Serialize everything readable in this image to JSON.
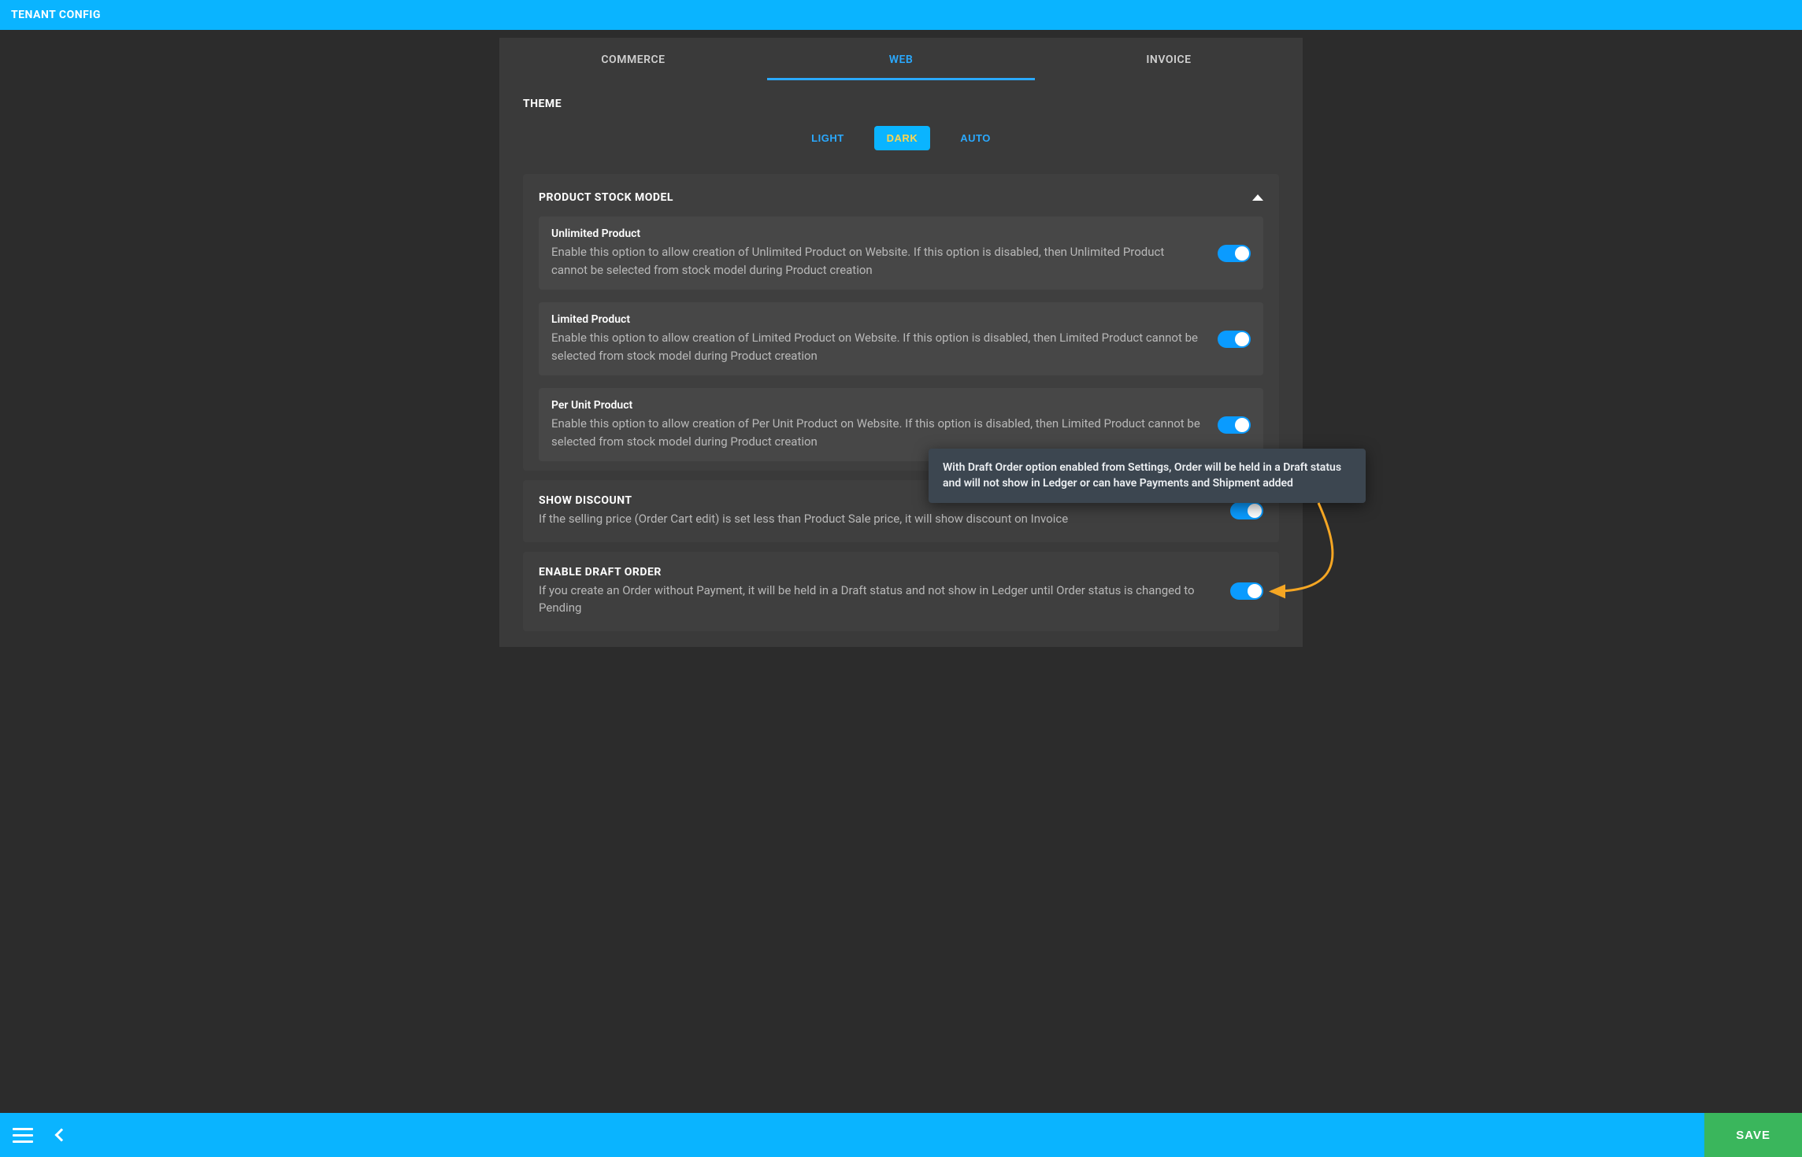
{
  "header": {
    "title": "TENANT CONFIG"
  },
  "tabs": {
    "commerce": "COMMERCE",
    "web": "WEB",
    "invoice": "INVOICE",
    "active": "web"
  },
  "theme": {
    "label": "THEME",
    "options": {
      "light": "LIGHT",
      "dark": "DARK",
      "auto": "AUTO"
    },
    "selected": "dark"
  },
  "stock_model": {
    "title": "PRODUCT STOCK MODEL",
    "expanded": true,
    "items": [
      {
        "title": "Unlimited Product",
        "desc": "Enable this option to allow creation of Unlimited Product on Website. If this option is disabled, then Unlimited Product cannot be selected from stock model during Product creation",
        "enabled": true
      },
      {
        "title": "Limited Product",
        "desc": "Enable this option to allow creation of Limited Product on Website. If this option is disabled, then Limited Product cannot be selected from stock model during Product creation",
        "enabled": true
      },
      {
        "title": "Per Unit Product",
        "desc": "Enable this option to allow creation of Per Unit Product on Website. If this option is disabled, then Limited Product cannot be selected from stock model during Product creation",
        "enabled": true
      }
    ]
  },
  "show_discount": {
    "title": "SHOW DISCOUNT",
    "desc": "If the selling price (Order Cart edit) is set less than Product Sale price, it will show discount on Invoice",
    "enabled": true
  },
  "draft_order": {
    "title": "ENABLE DRAFT ORDER",
    "desc": "If you create an Order without Payment, it will be held in a Draft status and not show in Ledger until Order status is changed to Pending",
    "enabled": true
  },
  "tooltip": {
    "text": "With Draft Order option enabled from Settings, Order will be held in a Draft status and will not show in Ledger or can have Payments and Shipment added"
  },
  "footer": {
    "save": "SAVE"
  }
}
